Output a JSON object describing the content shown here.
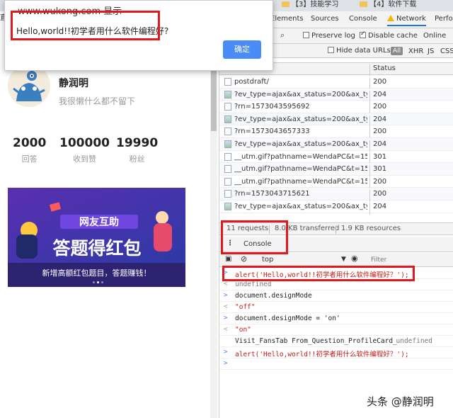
{
  "browser": {
    "url_fragment": "www.wukong.com 显示",
    "address_fragment": "直",
    "bookmarks": [
      "【3】技能学习",
      "【4】软件下载"
    ]
  },
  "alert": {
    "origin": "www.wukong.com 显示",
    "message": "Hello,world!!初学者用什么软件编程好?",
    "ok_label": "确定"
  },
  "profile": {
    "name": "静润明",
    "bio": "我很懒什么都不留下",
    "stats": [
      {
        "value": "2000",
        "label": "回答"
      },
      {
        "value": "100000",
        "label": "收到赞"
      },
      {
        "value": "19990",
        "label": "粉丝"
      }
    ]
  },
  "banner": {
    "title_top": "网友互助",
    "title_main": "答题得红包",
    "caption": "新增高额红包题目，答题赚钱！"
  },
  "devtools": {
    "tabs": [
      "Elements",
      "Sources",
      "Console",
      "Network",
      "Perfo"
    ],
    "preserve_log": "Preserve log",
    "disable_cache": "Disable cache",
    "online": "Online",
    "hide_data_urls": "Hide data URLs",
    "filter_all": "All",
    "filter_xhr": "XHR",
    "filter_js": "JS",
    "filter_css": "CSS",
    "col_name": "Name",
    "col_status": "Status",
    "rows": [
      {
        "name": "postdraft/",
        "status": "200",
        "img": false
      },
      {
        "name": "?ev_type=ajax&ax_status=200&ax_type...",
        "status": "204",
        "img": true
      },
      {
        "name": "?rn=1573043595692",
        "status": "200",
        "img": false
      },
      {
        "name": "?ev_type=ajax&ax_status=200&ax_type...",
        "status": "204",
        "img": true
      },
      {
        "name": "?rn=1573043657333",
        "status": "200",
        "img": false
      },
      {
        "name": "?ev_type=ajax&ax_status=200&ax_type...",
        "status": "204",
        "img": true
      },
      {
        "name": "__utm.gif?pathname=WendaPC&t=157...",
        "status": "301",
        "img": false
      },
      {
        "name": "__utm.gif?pathname=WendaPC&t=157...",
        "status": "301",
        "img": false
      },
      {
        "name": "__utm.gif?pathname=WendaPC&t=157...",
        "status": "200",
        "img": false
      },
      {
        "name": "?rn=1573043715621",
        "status": "200",
        "img": false
      },
      {
        "name": "?ev_type=ajax&ax_status=200&ax_type...",
        "status": "204",
        "img": true
      }
    ],
    "summary_requests": "11 requests",
    "summary_transferred": "8.0 KB transferred",
    "summary_resources": "1.9 KB resources",
    "drawer_tab": "Console",
    "context": "top",
    "filter_placeholder": "Filter",
    "console": [
      {
        "prompt": ">",
        "text": "alert('Hello,world!!初学者用什么软件编程好？');",
        "kind": "input"
      },
      {
        "prompt": "<",
        "text": "undefined",
        "kind": "gray"
      },
      {
        "prompt": ">",
        "text": "document.designMode",
        "kind": "input"
      },
      {
        "prompt": "<",
        "text": "\"off\"",
        "kind": "str"
      },
      {
        "prompt": ">",
        "text": "document.designMode = 'on'",
        "kind": "input"
      },
      {
        "prompt": "<",
        "text": "\"on\"",
        "kind": "str"
      },
      {
        "prompt": "",
        "text": "Visit_FansTab From_Question_ProfileCard_",
        "kind": "log",
        "right": "undefined"
      },
      {
        "prompt": ">",
        "text": "alert('Hello,world!!初学者用什么软件编程好？');",
        "kind": "input"
      },
      {
        "prompt": ">",
        "text": "",
        "kind": "input"
      }
    ]
  },
  "watermark": "头条 @静润明",
  "colors": {
    "accent": "#1a73e8",
    "highlight": "#e0191d",
    "ok_button": "#4a8cf7",
    "banner": "#3a2c8c"
  }
}
